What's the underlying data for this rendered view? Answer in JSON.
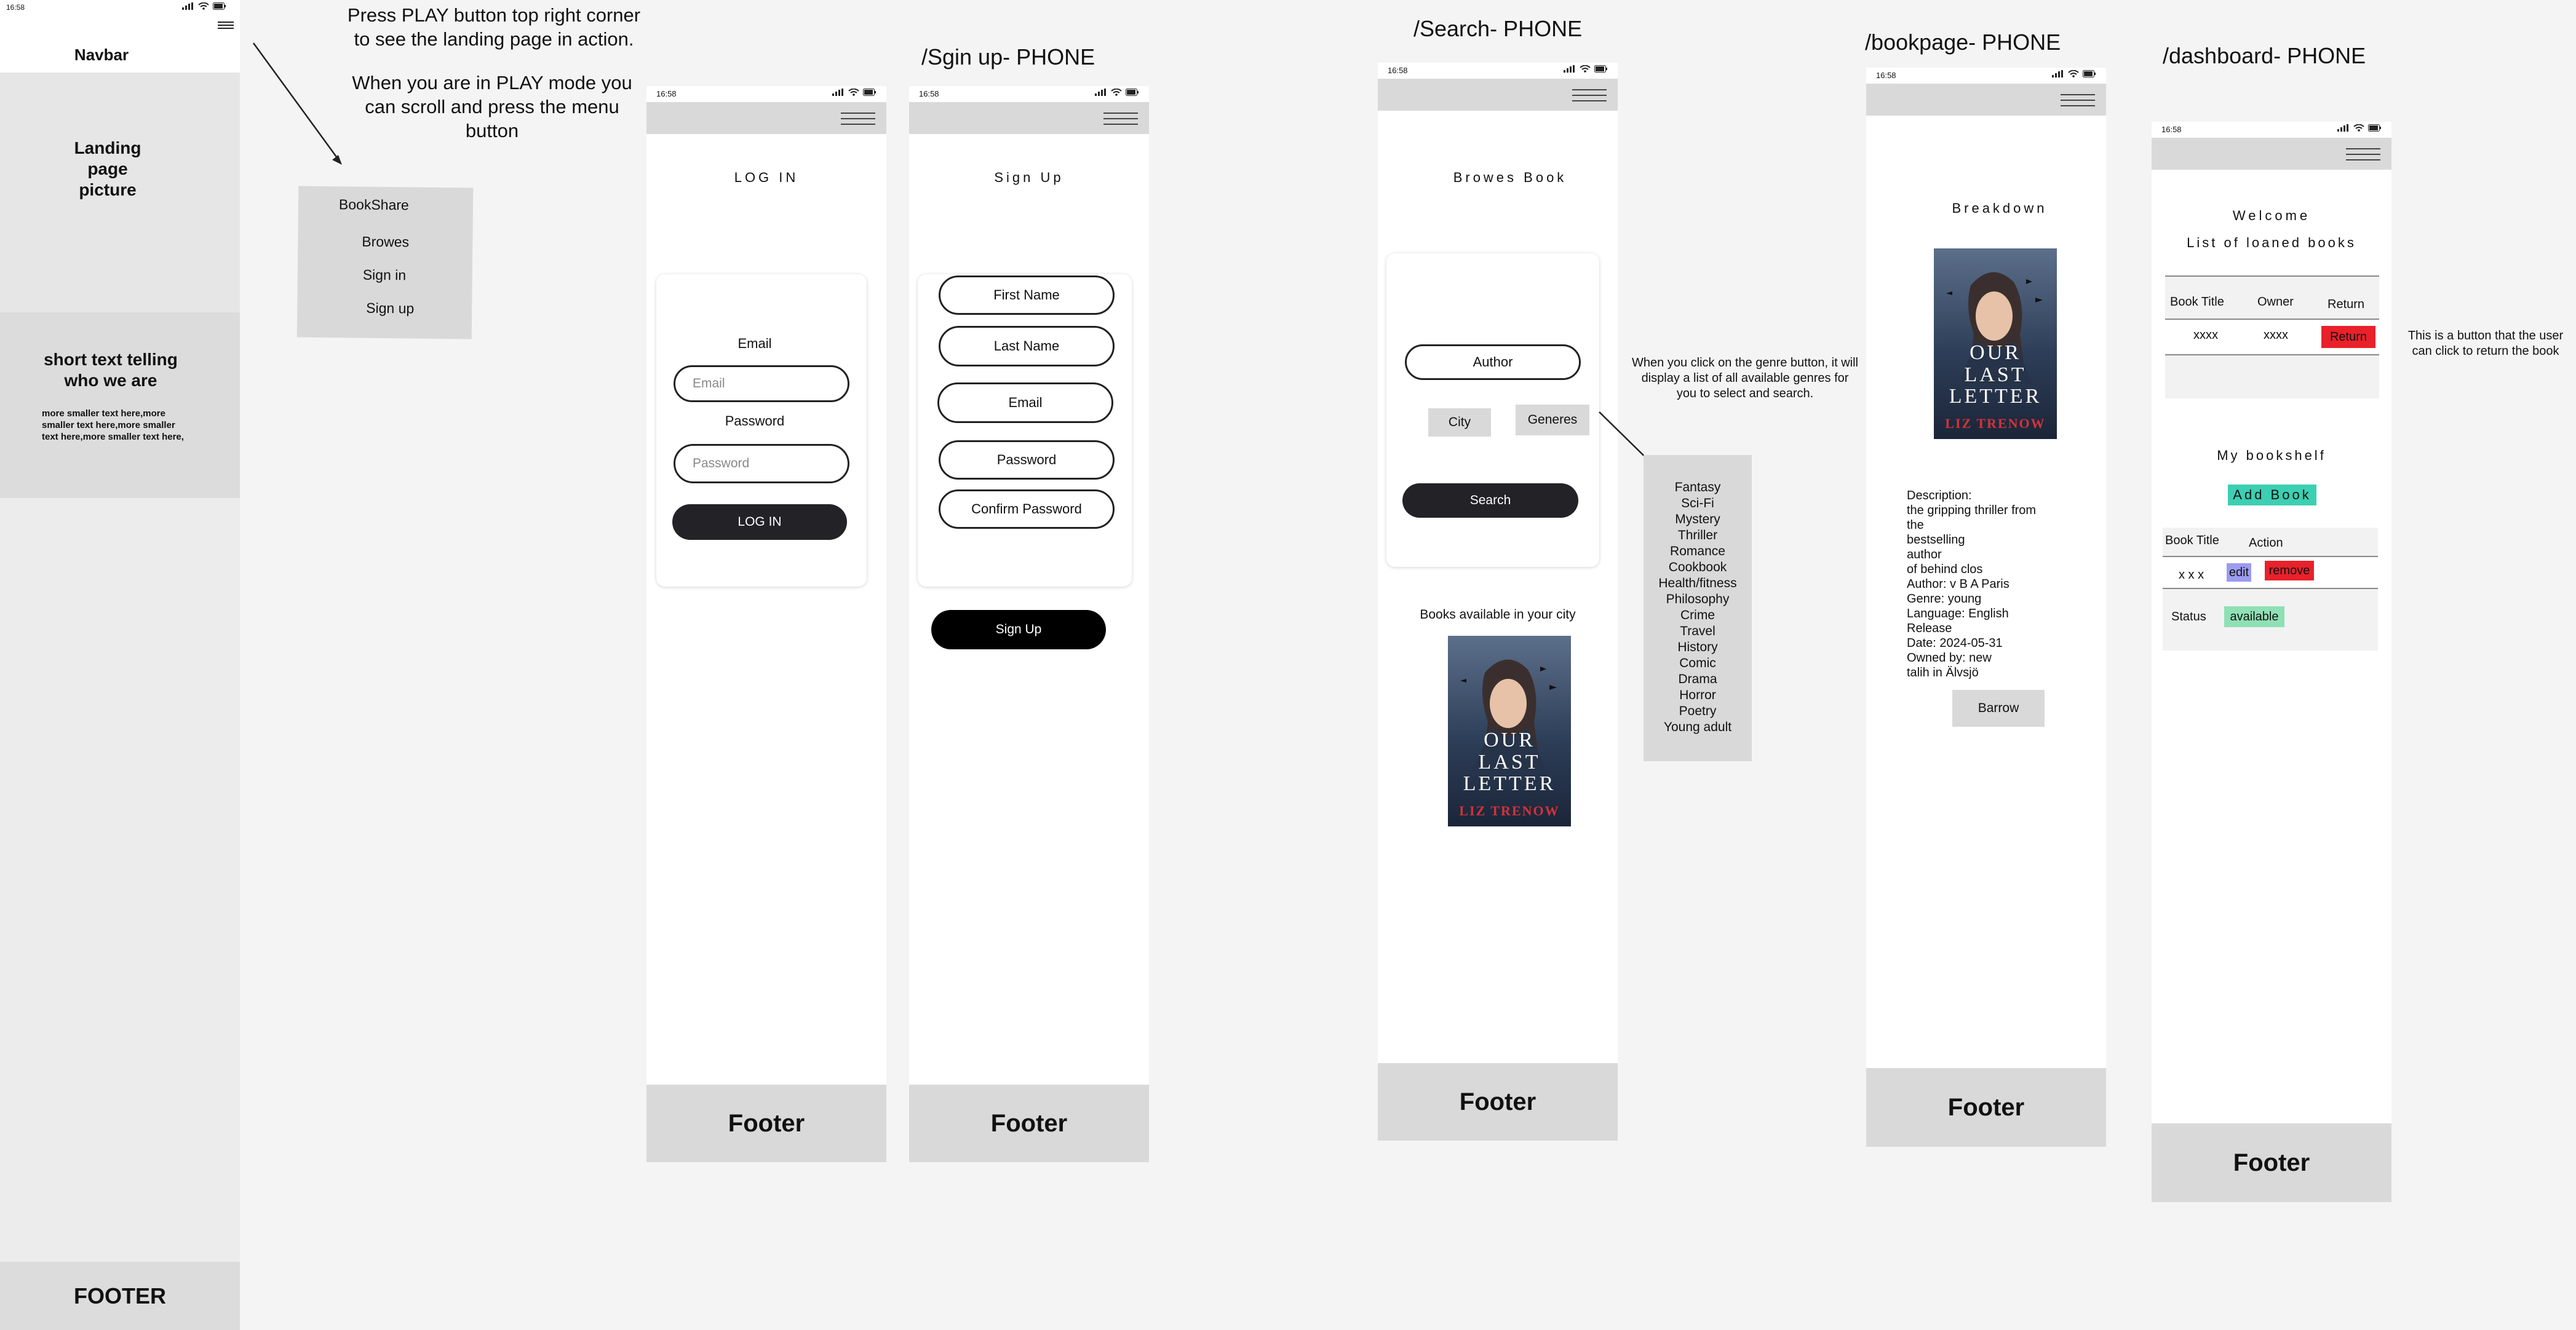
{
  "instructions": {
    "play_note": "Press PLAY button top right corner to see the landing page in action.",
    "play_mode_note": "When you are in PLAY mode you can scroll and press the menu button"
  },
  "status_time": "16:58",
  "landing": {
    "navbar": "Navbar",
    "picture": "Landing page picture",
    "who_title": "short text telling who we are",
    "who_text": "more smaller text here,more smaller text here,more smaller text here,more smaller text here,",
    "footer": "FOOTER"
  },
  "menu": {
    "items": [
      "BookShare",
      "Browes",
      "Sign in",
      "Sign up"
    ]
  },
  "login": {
    "title": "LOG IN",
    "email_label": "Email",
    "email_placeholder": "Email",
    "password_label": "Password",
    "password_placeholder": "Password",
    "button": "LOG IN",
    "footer": "Footer"
  },
  "signup": {
    "heading": "/Sgin up- PHONE",
    "title": "Sign Up",
    "fields": [
      "First Name",
      "Last Name",
      "Email",
      "Password",
      "Confirm Password"
    ],
    "button": "Sign Up",
    "footer": "Footer"
  },
  "search": {
    "heading": "/Search- PHONE",
    "title": "Browes Book",
    "author": "Author",
    "city": "City",
    "genres": "Generes",
    "button": "Search",
    "available": "Books available in your city",
    "footer": "Footer",
    "note": "When you click on the genre button, it will display a list of all available genres for you to select and search.",
    "genre_list": [
      "Fantasy",
      "Sci-Fi",
      "Mystery",
      "Thriller",
      "Romance",
      "Cookbook",
      "Health/fitness",
      "Philosophy",
      "Crime",
      "Travel",
      "History",
      "Comic",
      "Drama",
      "Horror",
      "Poetry",
      "Young adult"
    ]
  },
  "cover": {
    "title_lines": [
      "OUR",
      "LAST",
      "LETTER"
    ],
    "author": "LIZ TRENOW"
  },
  "bookpage": {
    "heading": "/bookpage- PHONE",
    "title": "Breakdown",
    "desc_lines": [
      "Description:",
      "the gripping thriller from",
      "the",
      " bestselling",
      " author",
      "of behind clos",
      "Author: v B A Paris",
      "Genre: young",
      "Language: English",
      "Release",
      "Date: 2024-05-31",
      "Owned by: new",
      "talih in Älvsjö"
    ],
    "button": "Barrow",
    "footer": "Footer"
  },
  "dashboard": {
    "heading": "/dashboard- PHONE",
    "welcome": "Welcome",
    "loaned_title": "List of loaned books",
    "loaned_headers": [
      "Book Title",
      "Owner",
      "Return"
    ],
    "loaned_row": {
      "title": "xxxx",
      "owner": "xxxx",
      "action": "Return"
    },
    "note": "This is a button that the user can click to return the book",
    "shelf_title": "My bookshelf",
    "add_button": "Add Book",
    "shelf_headers": [
      "Book Title",
      "Action"
    ],
    "shelf_row": {
      "title": "x x x",
      "edit": "edit",
      "remove": "remove"
    },
    "status_label": "Status",
    "status_value": "available",
    "footer": "Footer"
  },
  "colors": {
    "panel_gray": "#d9d9d9",
    "dark_button": "#222227",
    "return_red": "#e8212b",
    "remove_red": "#e8212b",
    "edit_blue": "#9b9bf0",
    "add_teal": "#3ccfb2",
    "available_green": "#8fe0b4"
  }
}
